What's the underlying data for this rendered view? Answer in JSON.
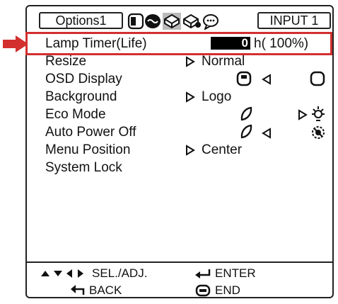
{
  "header": {
    "tab_label": "Options1",
    "input_label": "INPUT 1"
  },
  "menu": {
    "lamp_timer": {
      "label": "Lamp Timer(Life)",
      "hours": "0",
      "unit": "h",
      "life": "( 100%)"
    },
    "resize": {
      "label": "Resize",
      "value": "Normal"
    },
    "osd_display": {
      "label": "OSD Display"
    },
    "background": {
      "label": "Background",
      "value": "Logo"
    },
    "eco_mode": {
      "label": "Eco Mode"
    },
    "auto_power_off": {
      "label": "Auto Power Off"
    },
    "menu_position": {
      "label": "Menu Position",
      "value": "Center"
    },
    "system_lock": {
      "label": "System Lock"
    }
  },
  "footer": {
    "select_adjust": "SEL./ADJ.",
    "enter": "ENTER",
    "back": "BACK",
    "end": "END"
  },
  "colors": {
    "highlight": "#d32f2f"
  }
}
